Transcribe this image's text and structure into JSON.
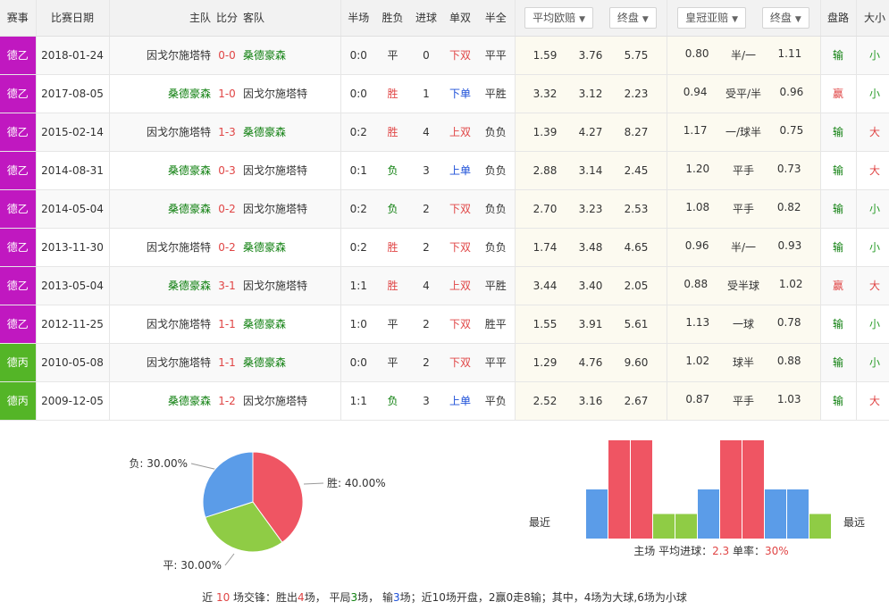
{
  "headers": {
    "league": "赛事",
    "date": "比赛日期",
    "home": "主队",
    "score": "比分",
    "away": "客队",
    "half": "半场",
    "result": "胜负",
    "goals": "进球",
    "oddeven": "单双",
    "htft": "半全",
    "avg_odds": "平均欧赔",
    "final1": "终盘",
    "crown_asia": "皇冠亚赔",
    "final2": "终盘",
    "handicap_result": "盘路",
    "size": "大小"
  },
  "colors": {
    "league_2bl": "#c018c0",
    "league_3l": "#54b527",
    "home_win": "#e04545",
    "away_win": "#0e7f0e"
  },
  "rows": [
    {
      "league": "德乙",
      "league_key": "2bl",
      "date": "2018-01-24",
      "home": "因戈尔施塔特",
      "home_color": "gray",
      "score": "0-0",
      "away": "桑德豪森",
      "away_color": "green",
      "half": "0:0",
      "result": "平",
      "result_class": "gray",
      "goals": "0",
      "oddeven": "下双",
      "oddeven_class": "red",
      "htft": "平平",
      "o1": "1.59",
      "o2": "3.76",
      "o3": "5.75",
      "a1": "0.80",
      "a2": "半/一",
      "a3": "1.11",
      "hr": "输",
      "hr_class": "c-lose",
      "sz": "小",
      "sz_class": "c-small"
    },
    {
      "league": "德乙",
      "league_key": "2bl",
      "date": "2017-08-05",
      "home": "桑德豪森",
      "home_color": "green",
      "score": "1-0",
      "away": "因戈尔施塔特",
      "away_color": "gray",
      "half": "0:0",
      "result": "胜",
      "result_class": "red",
      "goals": "1",
      "oddeven": "下单",
      "oddeven_class": "blue",
      "htft": "平胜",
      "o1": "3.32",
      "o2": "3.12",
      "o3": "2.23",
      "a1": "0.94",
      "a2": "受平/半",
      "a3": "0.96",
      "hr": "赢",
      "hr_class": "c-win",
      "sz": "小",
      "sz_class": "c-small"
    },
    {
      "league": "德乙",
      "league_key": "2bl",
      "date": "2015-02-14",
      "home": "因戈尔施塔特",
      "home_color": "gray",
      "score": "1-3",
      "away": "桑德豪森",
      "away_color": "green",
      "half": "0:2",
      "result": "胜",
      "result_class": "red",
      "goals": "4",
      "oddeven": "上双",
      "oddeven_class": "red",
      "htft": "负负",
      "o1": "1.39",
      "o2": "4.27",
      "o3": "8.27",
      "a1": "1.17",
      "a2": "一/球半",
      "a3": "0.75",
      "hr": "输",
      "hr_class": "c-lose",
      "sz": "大",
      "sz_class": "c-big"
    },
    {
      "league": "德乙",
      "league_key": "2bl",
      "date": "2014-08-31",
      "home": "桑德豪森",
      "home_color": "green",
      "score": "0-3",
      "away": "因戈尔施塔特",
      "away_color": "gray",
      "half": "0:1",
      "result": "负",
      "result_class": "green",
      "goals": "3",
      "oddeven": "上单",
      "oddeven_class": "blue",
      "htft": "负负",
      "o1": "2.88",
      "o2": "3.14",
      "o3": "2.45",
      "a1": "1.20",
      "a2": "平手",
      "a3": "0.73",
      "hr": "输",
      "hr_class": "c-lose",
      "sz": "大",
      "sz_class": "c-big"
    },
    {
      "league": "德乙",
      "league_key": "2bl",
      "date": "2014-05-04",
      "home": "桑德豪森",
      "home_color": "green",
      "score": "0-2",
      "away": "因戈尔施塔特",
      "away_color": "gray",
      "half": "0:2",
      "result": "负",
      "result_class": "green",
      "goals": "2",
      "oddeven": "下双",
      "oddeven_class": "red",
      "htft": "负负",
      "o1": "2.70",
      "o2": "3.23",
      "o3": "2.53",
      "a1": "1.08",
      "a2": "平手",
      "a3": "0.82",
      "hr": "输",
      "hr_class": "c-lose",
      "sz": "小",
      "sz_class": "c-small"
    },
    {
      "league": "德乙",
      "league_key": "2bl",
      "date": "2013-11-30",
      "home": "因戈尔施塔特",
      "home_color": "gray",
      "score": "0-2",
      "away": "桑德豪森",
      "away_color": "green",
      "half": "0:2",
      "result": "胜",
      "result_class": "red",
      "goals": "2",
      "oddeven": "下双",
      "oddeven_class": "red",
      "htft": "负负",
      "o1": "1.74",
      "o2": "3.48",
      "o3": "4.65",
      "a1": "0.96",
      "a2": "半/一",
      "a3": "0.93",
      "hr": "输",
      "hr_class": "c-lose",
      "sz": "小",
      "sz_class": "c-small"
    },
    {
      "league": "德乙",
      "league_key": "2bl",
      "date": "2013-05-04",
      "home": "桑德豪森",
      "home_color": "green",
      "score": "3-1",
      "away": "因戈尔施塔特",
      "away_color": "gray",
      "half": "1:1",
      "result": "胜",
      "result_class": "red",
      "goals": "4",
      "oddeven": "上双",
      "oddeven_class": "red",
      "htft": "平胜",
      "o1": "3.44",
      "o2": "3.40",
      "o3": "2.05",
      "a1": "0.88",
      "a2": "受半球",
      "a3": "1.02",
      "hr": "赢",
      "hr_class": "c-win",
      "sz": "大",
      "sz_class": "c-big"
    },
    {
      "league": "德乙",
      "league_key": "2bl",
      "date": "2012-11-25",
      "home": "因戈尔施塔特",
      "home_color": "gray",
      "score": "1-1",
      "away": "桑德豪森",
      "away_color": "green",
      "half": "1:0",
      "result": "平",
      "result_class": "gray",
      "goals": "2",
      "oddeven": "下双",
      "oddeven_class": "red",
      "htft": "胜平",
      "o1": "1.55",
      "o2": "3.91",
      "o3": "5.61",
      "a1": "1.13",
      "a2": "一球",
      "a3": "0.78",
      "hr": "输",
      "hr_class": "c-lose",
      "sz": "小",
      "sz_class": "c-small"
    },
    {
      "league": "德丙",
      "league_key": "3l",
      "date": "2010-05-08",
      "home": "因戈尔施塔特",
      "home_color": "gray",
      "score": "1-1",
      "away": "桑德豪森",
      "away_color": "green",
      "half": "0:0",
      "result": "平",
      "result_class": "gray",
      "goals": "2",
      "oddeven": "下双",
      "oddeven_class": "red",
      "htft": "平平",
      "o1": "1.29",
      "o2": "4.76",
      "o3": "9.60",
      "a1": "1.02",
      "a2": "球半",
      "a3": "0.88",
      "hr": "输",
      "hr_class": "c-lose",
      "sz": "小",
      "sz_class": "c-small"
    },
    {
      "league": "德丙",
      "league_key": "3l",
      "date": "2009-12-05",
      "home": "桑德豪森",
      "home_color": "green",
      "score": "1-2",
      "away": "因戈尔施塔特",
      "away_color": "gray",
      "half": "1:1",
      "result": "负",
      "result_class": "green",
      "goals": "3",
      "oddeven": "上单",
      "oddeven_class": "blue",
      "htft": "平负",
      "o1": "2.52",
      "o2": "3.16",
      "o3": "2.67",
      "a1": "0.87",
      "a2": "平手",
      "a3": "1.03",
      "hr": "输",
      "hr_class": "c-lose",
      "sz": "大",
      "sz_class": "c-big"
    }
  ],
  "chart_data": [
    {
      "type": "pie",
      "categories": [
        "胜",
        "负",
        "平"
      ],
      "values": [
        40,
        30,
        30
      ],
      "labels": [
        "胜: 40.00%",
        "负: 30.00%",
        "平: 30.00%"
      ],
      "colors": [
        "#ef5563",
        "#8fcc45",
        "#5b9ce8"
      ]
    },
    {
      "type": "bar",
      "labels": {
        "left": "最近",
        "right": "最远"
      },
      "values": [
        2,
        4,
        4,
        1,
        1,
        2,
        4,
        4,
        2,
        2,
        1
      ],
      "colors": [
        "#5b9ce8",
        "#ef5563",
        "#ef5563",
        "#8fcc45",
        "#8fcc45",
        "#5b9ce8",
        "#ef5563",
        "#ef5563",
        "#5b9ce8",
        "#5b9ce8",
        "#8fcc45"
      ],
      "caption": {
        "prefix": "主场  平均进球：",
        "avg": "2.3",
        "mid": " 单率：",
        "rate": "30%"
      }
    }
  ],
  "summary": {
    "p1": "近 ",
    "n": "10",
    "p2": " 场交锋：胜出",
    "win": "4",
    "p3": "场，  平局",
    "draw": "3",
    "p4": "场，  输",
    "lose": "3",
    "p5": "场；近10场开盘，2赢0走8输；其中，4场为大球,6场为小球"
  }
}
